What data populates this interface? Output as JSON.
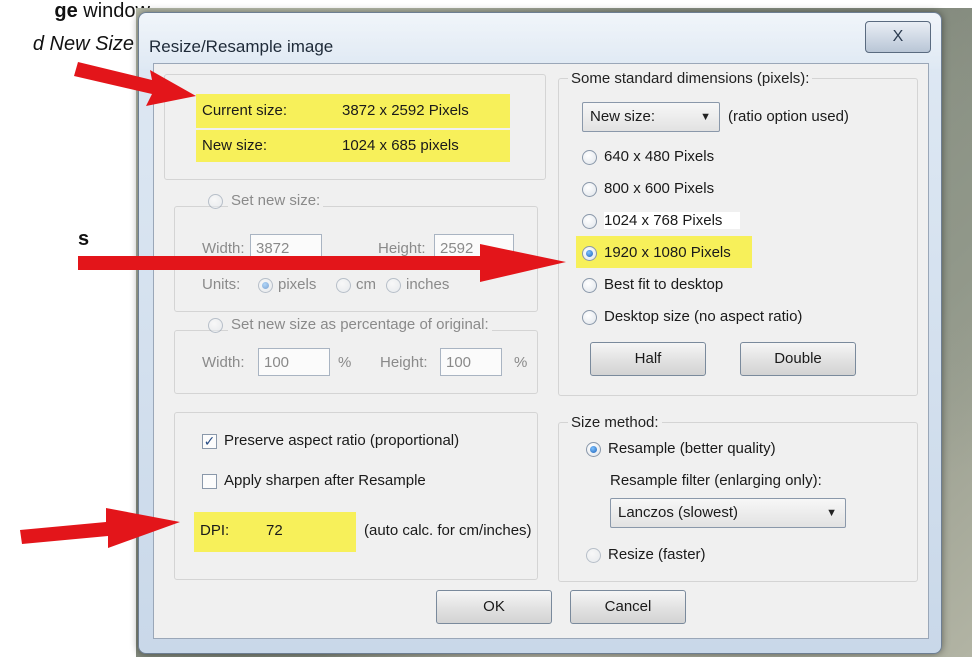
{
  "page": {
    "text_line1_bold": "ge",
    "text_line1_rest": "window",
    "text_line2": "d New Size",
    "text_line3": "s"
  },
  "dialog": {
    "title": "Resize/Resample image",
    "close_glyph": "X",
    "current_size": {
      "label": "Current size:",
      "value": "3872 x 2592 Pixels"
    },
    "new_size": {
      "label": "New size:",
      "value": "1024 x 685 pixels"
    },
    "set_new_size": {
      "label": "Set new size:",
      "width_label": "Width:",
      "width_value": "3872",
      "height_label": "Height:",
      "height_value": "2592",
      "units_label": "Units:",
      "units": [
        "pixels",
        "cm",
        "inches"
      ]
    },
    "percentage": {
      "label": "Set new size as percentage of original:",
      "width_label": "Width:",
      "width_value": "100",
      "width_unit": "%",
      "height_label": "Height:",
      "height_value": "100",
      "height_unit": "%"
    },
    "options": {
      "preserve_label": "Preserve aspect ratio (proportional)",
      "sharpen_label": "Apply sharpen after Resample",
      "dpi_label": "DPI:",
      "dpi_value": "72",
      "dpi_note": "(auto calc. for cm/inches)"
    },
    "standard": {
      "title": "Some standard dimensions (pixels):",
      "select_value": "New size:",
      "select_note": "(ratio option used)",
      "items": [
        "640 x 480 Pixels",
        "800 x 600 Pixels",
        "1024 x 768 Pixels",
        "1920 x 1080 Pixels",
        "Best fit to desktop",
        "Desktop size (no aspect ratio)"
      ],
      "half_label": "Half",
      "double_label": "Double"
    },
    "method": {
      "title": "Size method:",
      "resample_label": "Resample (better quality)",
      "filter_label": "Resample filter (enlarging only):",
      "filter_value": "Lanczos (slowest)",
      "resize_label": "Resize (faster)"
    },
    "ok_label": "OK",
    "cancel_label": "Cancel"
  },
  "colors": {
    "highlight": "#f7f05a",
    "arrow": "#e3151a",
    "accent": "#1e62b8"
  }
}
